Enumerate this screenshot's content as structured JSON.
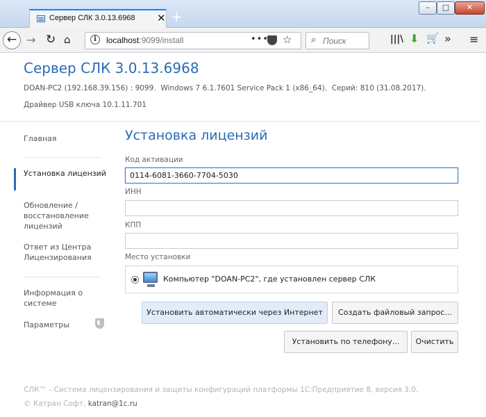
{
  "browser": {
    "tab_title": "Сервер СЛК 3.0.13.6968",
    "tab_close": "✕",
    "new_tab": "+",
    "url_host": "localhost",
    "url_path": ":9099/install",
    "url_more": "•••",
    "search_placeholder": "Поиск",
    "window_buttons": {
      "minimize": "–",
      "maximize": "□",
      "close": "✕"
    }
  },
  "header": {
    "title": "Сервер СЛК 3.0.13.6968",
    "host": "DOAN-PC2 (192.168.39.156) : 9099",
    "os": "Windows 7 6.1.7601 Service Pack 1 (x86_64)",
    "serial": "Серий: 810 (31.08.2017)",
    "sep": ",",
    "driver": "Драйвер USB ключа 10.1.11.701"
  },
  "sidebar": {
    "items": [
      {
        "label": "Главная"
      },
      {
        "label": "Установка лицензий"
      },
      {
        "label": "Обновление / восстановление лицензий"
      },
      {
        "label": "Ответ из Центра Лицензирования"
      },
      {
        "label": "Информация о системе"
      },
      {
        "label": "Параметры"
      }
    ]
  },
  "main": {
    "title": "Установка лицензий",
    "activation_label": "Код активации",
    "activation_value": "0114-6081-3660-7704-5030",
    "inn_label": "ИНН",
    "inn_value": "",
    "kpp_label": "КПП",
    "kpp_value": "",
    "place_label": "Место установки",
    "place_option": "Компьютер \"DOAN-PC2\", где установлен сервер СЛК",
    "btn_internet": "Установить автоматически через Интернет",
    "btn_file": "Создать файловый запрос...",
    "btn_phone": "Установить по телефону...",
    "btn_clear": "Очистить"
  },
  "footer": {
    "line1": "СЛК™ - Система лицензирования и защиты конфигураций платформы 1С:Предприятие 8, версия 3.0.",
    "copyright": "© Катран Софт,",
    "email": "katran@1c.ru"
  },
  "colors": {
    "accent": "#2a6bb4",
    "muted": "#b4b4b4"
  }
}
